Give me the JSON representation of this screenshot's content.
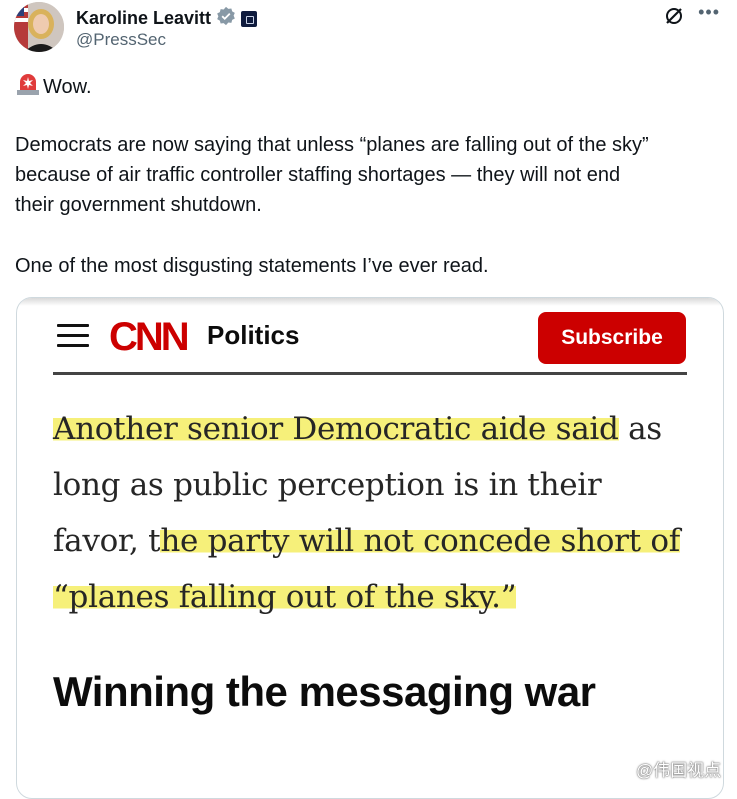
{
  "author": {
    "display_name": "Karoline Leavitt",
    "handle": "@PressSec"
  },
  "tweet": {
    "line1": "Wow.",
    "para1_line1": "Democrats are now saying that unless “planes are falling out of the sky”",
    "para1_line2": "because of air traffic controller staffing shortages — they will not end",
    "para1_line3": "their government shutdown.",
    "para2": "One of the most disgusting statements I’ve ever read."
  },
  "card": {
    "logo_text": "CNN",
    "section": "Politics",
    "subscribe_label": "Subscribe",
    "quote": {
      "l1_hl": "Another senior Democratic aide said",
      "l1_rest": " as",
      "l2": "long as public perception is in their",
      "l3_pre": "favor, t",
      "l3_hl": "he party will not concede short of",
      "l4_hl": "“planes falling out of the sky.”"
    },
    "headline": "Winning the messaging war"
  },
  "watermark": {
    "text": "@伟国视点"
  },
  "colors": {
    "verified_badge": "#1d9bf0",
    "subscribe_bg": "#cc0000",
    "highlight": "#f6f07a"
  },
  "icons": [
    "siren-emoji-icon",
    "verified-badge-icon",
    "affiliate-badge-icon",
    "grok-icon",
    "more-icon",
    "menu-icon",
    "weibo-icon"
  ]
}
